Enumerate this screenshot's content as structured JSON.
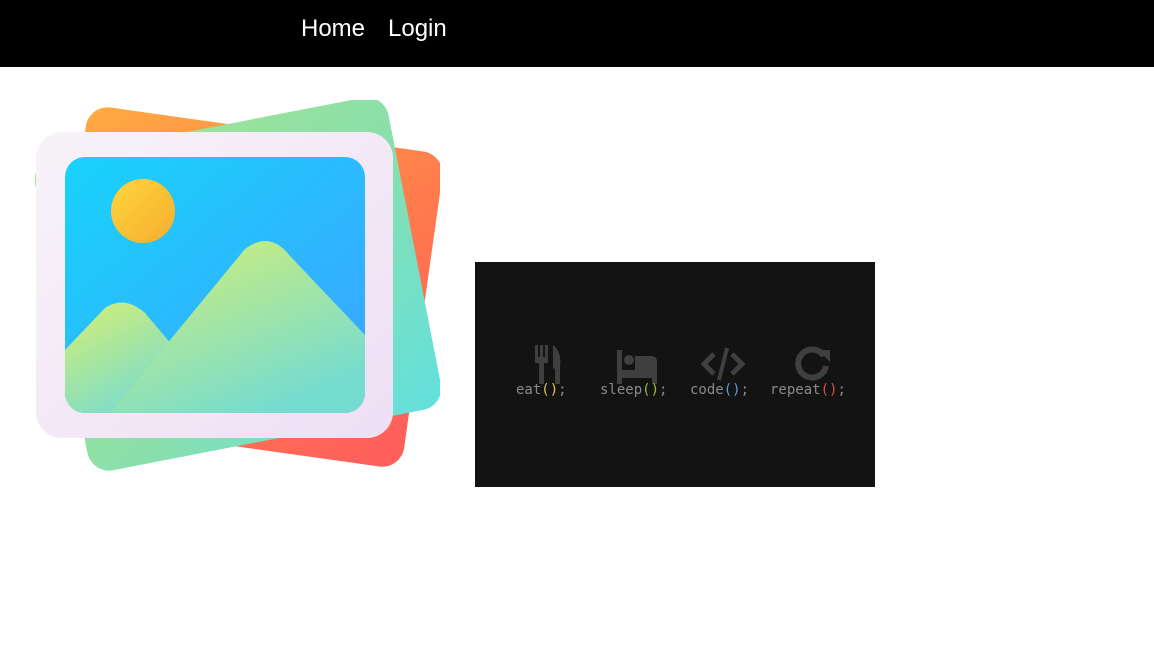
{
  "nav": {
    "home_label": "Home",
    "login_label": "Login"
  },
  "gallery_image": {
    "icon": "image-gallery-icon"
  },
  "code_banner": {
    "items": [
      {
        "icon": "fork-knife-icon",
        "name": "eat",
        "parens": "()",
        "semicolon": ";",
        "accent": "#d7c94a"
      },
      {
        "icon": "bed-icon",
        "name": "sleep",
        "parens": "()",
        "semicolon": ";",
        "accent": "#96bb45"
      },
      {
        "icon": "code-icon",
        "name": "code",
        "parens": "()",
        "semicolon": ";",
        "accent": "#5f97d8"
      },
      {
        "icon": "refresh-icon",
        "name": "repeat",
        "parens": "()",
        "semicolon": ";",
        "accent": "#d45442"
      }
    ]
  }
}
